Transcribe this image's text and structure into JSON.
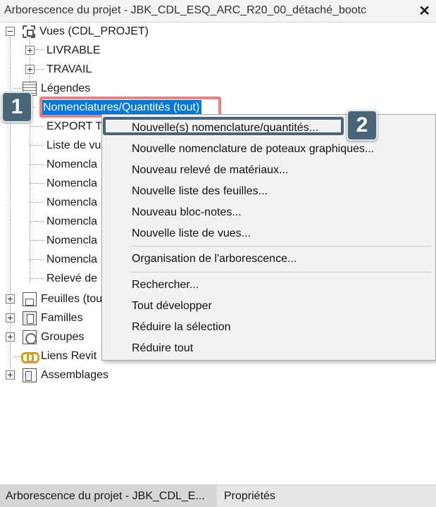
{
  "window": {
    "title": "Arborescence du projet - JBK_CDL_ESQ_ARC_R20_00_détaché_bootc",
    "close_glyph": "✕"
  },
  "tree": {
    "views_root": "Vues (CDL_PROJET)",
    "livrable": "LIVRABLE",
    "travail": "TRAVAIL",
    "legendes": "Légendes",
    "nomenclatures": "Nomenclatures/Quantités (tout)",
    "children": [
      "EXPORT TA",
      "Liste de vu",
      "Nomencla",
      "Nomencla",
      "Nomencla",
      "Nomencla",
      "Nomencla",
      "Nomencla",
      "Relevé de"
    ],
    "feuilles": "Feuilles (tou",
    "familles": "Familles",
    "groupes": "Groupes",
    "liens": "Liens Revit",
    "assemblages": "Assemblages"
  },
  "callouts": {
    "one": "1",
    "two": "2",
    "color_one": "#f08080",
    "color_two": "#4a6478"
  },
  "context_menu": {
    "items_group1": [
      "Nouvelle(s) nomenclature/quantités...",
      "Nouvelle nomenclature de poteaux graphiques...",
      "Nouveau relevé de matériaux...",
      "Nouvelle liste des feuilles...",
      "Nouveau bloc-notes...",
      "Nouvelle liste de vues..."
    ],
    "items_group2": [
      "Organisation de l'arborescence..."
    ],
    "items_group3": [
      "Rechercher...",
      "Tout développer",
      "Réduire la sélection",
      "Réduire tout"
    ]
  },
  "tabs": {
    "project_browser": "Arborescence du projet - JBK_CDL_E...",
    "properties": "Propriétés"
  },
  "colors": {
    "selection": "#0078d7"
  }
}
